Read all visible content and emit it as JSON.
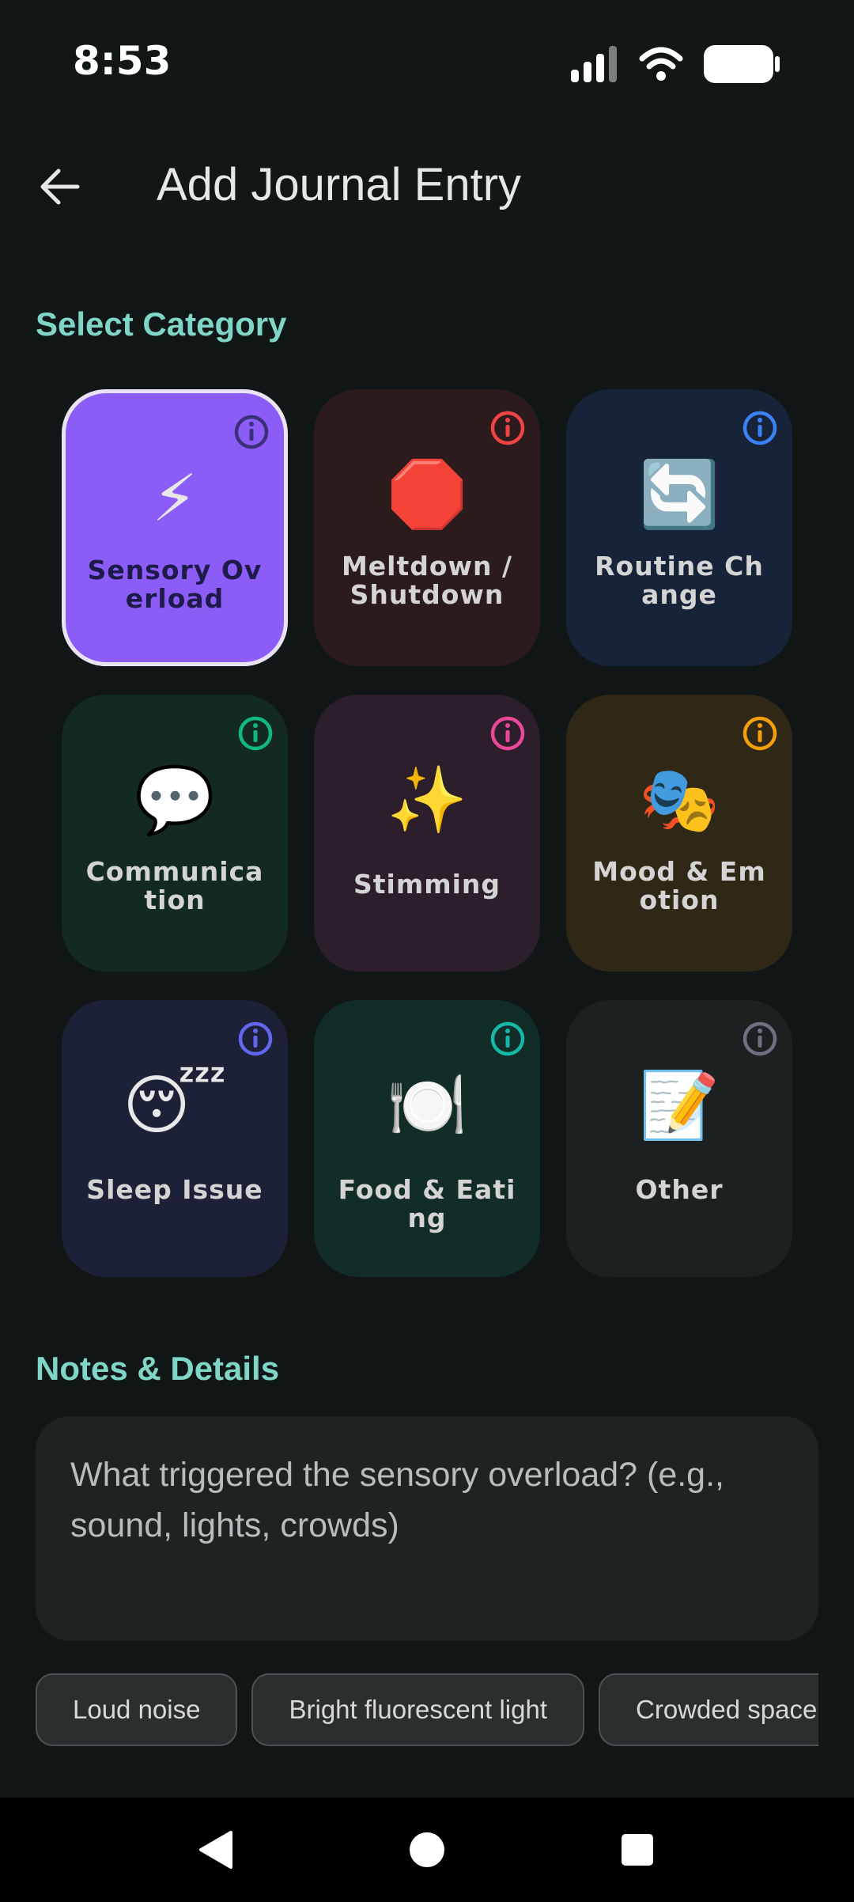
{
  "status_bar": {
    "time": "8:53"
  },
  "app_bar": {
    "title": "Add Journal Entry"
  },
  "category_section": {
    "heading": "Select Category",
    "categories": [
      {
        "label": "Sensory Overload",
        "emoji": "⚡",
        "bg": "#8b5cf6",
        "label_color": "#1e1b4b",
        "info_color": "#3b2f7a",
        "selected": true
      },
      {
        "label": "Meltdown / Shutdown",
        "emoji": "🛑",
        "bg": "#2c1b1d",
        "label_color": "#d4d4d4",
        "info_color": "#ef4444",
        "selected": false
      },
      {
        "label": "Routine Change",
        "emoji": "🔄",
        "bg": "#172338",
        "label_color": "#d4d4d4",
        "info_color": "#3b82f6",
        "selected": false
      },
      {
        "label": "Communication",
        "emoji": "💬",
        "bg": "#122a23",
        "label_color": "#d4d4d4",
        "info_color": "#10b981",
        "selected": false
      },
      {
        "label": "Stimming",
        "emoji": "✨",
        "bg": "#2c1e2a",
        "label_color": "#d4d4d4",
        "info_color": "#ec4899",
        "selected": false
      },
      {
        "label": "Mood & Emotion",
        "emoji": "🎭",
        "bg": "#302816",
        "label_color": "#d4d4d4",
        "info_color": "#f59e0b",
        "selected": false
      },
      {
        "label": "Sleep Issue",
        "emoji": "😴",
        "bg": "#1c2138",
        "label_color": "#d4d4d4",
        "info_color": "#6366f1",
        "selected": false
      },
      {
        "label": "Food & Eating",
        "emoji": "🍽️",
        "bg": "#122c28",
        "label_color": "#d4d4d4",
        "info_color": "#14b8a6",
        "selected": false
      },
      {
        "label": "Other",
        "emoji": "📝",
        "bg": "#1d2021",
        "label_color": "#d4d4d4",
        "info_color": "#6b7280",
        "selected": false
      }
    ]
  },
  "notes_section": {
    "heading": "Notes & Details",
    "placeholder": "What triggered the sensory overload? (e.g., sound, lights, crowds)",
    "value": ""
  },
  "suggestions": [
    "Loud noise",
    "Bright fluorescent light",
    "Crowded space"
  ],
  "nav": {
    "back": "back-triangle-icon",
    "home": "home-circle-icon",
    "recents": "recents-square-icon"
  }
}
